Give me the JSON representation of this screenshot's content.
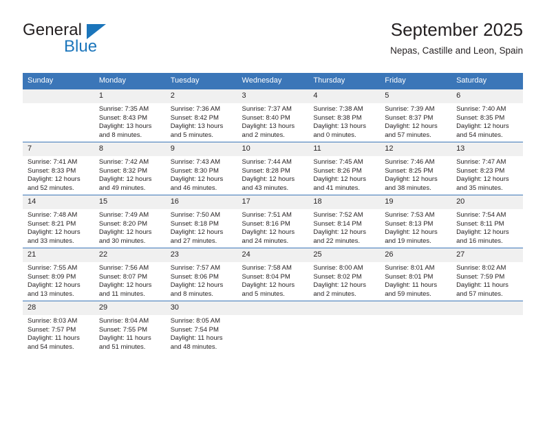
{
  "brand": {
    "name_part1": "General",
    "name_part2": "Blue",
    "triangle_icon": "brand-triangle-icon",
    "accent_color": "#1b75bb"
  },
  "header": {
    "month_title": "September 2025",
    "location": "Nepas, Castille and Leon, Spain"
  },
  "calendar": {
    "header_color": "#3b76b8",
    "daynum_background": "#f0f0f0",
    "weekday_headers": [
      "Sunday",
      "Monday",
      "Tuesday",
      "Wednesday",
      "Thursday",
      "Friday",
      "Saturday"
    ],
    "weeks": [
      [
        {
          "day": "",
          "lines": []
        },
        {
          "day": "1",
          "lines": [
            "Sunrise: 7:35 AM",
            "Sunset: 8:43 PM",
            "Daylight: 13 hours",
            "and 8 minutes."
          ]
        },
        {
          "day": "2",
          "lines": [
            "Sunrise: 7:36 AM",
            "Sunset: 8:42 PM",
            "Daylight: 13 hours",
            "and 5 minutes."
          ]
        },
        {
          "day": "3",
          "lines": [
            "Sunrise: 7:37 AM",
            "Sunset: 8:40 PM",
            "Daylight: 13 hours",
            "and 2 minutes."
          ]
        },
        {
          "day": "4",
          "lines": [
            "Sunrise: 7:38 AM",
            "Sunset: 8:38 PM",
            "Daylight: 13 hours",
            "and 0 minutes."
          ]
        },
        {
          "day": "5",
          "lines": [
            "Sunrise: 7:39 AM",
            "Sunset: 8:37 PM",
            "Daylight: 12 hours",
            "and 57 minutes."
          ]
        },
        {
          "day": "6",
          "lines": [
            "Sunrise: 7:40 AM",
            "Sunset: 8:35 PM",
            "Daylight: 12 hours",
            "and 54 minutes."
          ]
        }
      ],
      [
        {
          "day": "7",
          "lines": [
            "Sunrise: 7:41 AM",
            "Sunset: 8:33 PM",
            "Daylight: 12 hours",
            "and 52 minutes."
          ]
        },
        {
          "day": "8",
          "lines": [
            "Sunrise: 7:42 AM",
            "Sunset: 8:32 PM",
            "Daylight: 12 hours",
            "and 49 minutes."
          ]
        },
        {
          "day": "9",
          "lines": [
            "Sunrise: 7:43 AM",
            "Sunset: 8:30 PM",
            "Daylight: 12 hours",
            "and 46 minutes."
          ]
        },
        {
          "day": "10",
          "lines": [
            "Sunrise: 7:44 AM",
            "Sunset: 8:28 PM",
            "Daylight: 12 hours",
            "and 43 minutes."
          ]
        },
        {
          "day": "11",
          "lines": [
            "Sunrise: 7:45 AM",
            "Sunset: 8:26 PM",
            "Daylight: 12 hours",
            "and 41 minutes."
          ]
        },
        {
          "day": "12",
          "lines": [
            "Sunrise: 7:46 AM",
            "Sunset: 8:25 PM",
            "Daylight: 12 hours",
            "and 38 minutes."
          ]
        },
        {
          "day": "13",
          "lines": [
            "Sunrise: 7:47 AM",
            "Sunset: 8:23 PM",
            "Daylight: 12 hours",
            "and 35 minutes."
          ]
        }
      ],
      [
        {
          "day": "14",
          "lines": [
            "Sunrise: 7:48 AM",
            "Sunset: 8:21 PM",
            "Daylight: 12 hours",
            "and 33 minutes."
          ]
        },
        {
          "day": "15",
          "lines": [
            "Sunrise: 7:49 AM",
            "Sunset: 8:20 PM",
            "Daylight: 12 hours",
            "and 30 minutes."
          ]
        },
        {
          "day": "16",
          "lines": [
            "Sunrise: 7:50 AM",
            "Sunset: 8:18 PM",
            "Daylight: 12 hours",
            "and 27 minutes."
          ]
        },
        {
          "day": "17",
          "lines": [
            "Sunrise: 7:51 AM",
            "Sunset: 8:16 PM",
            "Daylight: 12 hours",
            "and 24 minutes."
          ]
        },
        {
          "day": "18",
          "lines": [
            "Sunrise: 7:52 AM",
            "Sunset: 8:14 PM",
            "Daylight: 12 hours",
            "and 22 minutes."
          ]
        },
        {
          "day": "19",
          "lines": [
            "Sunrise: 7:53 AM",
            "Sunset: 8:13 PM",
            "Daylight: 12 hours",
            "and 19 minutes."
          ]
        },
        {
          "day": "20",
          "lines": [
            "Sunrise: 7:54 AM",
            "Sunset: 8:11 PM",
            "Daylight: 12 hours",
            "and 16 minutes."
          ]
        }
      ],
      [
        {
          "day": "21",
          "lines": [
            "Sunrise: 7:55 AM",
            "Sunset: 8:09 PM",
            "Daylight: 12 hours",
            "and 13 minutes."
          ]
        },
        {
          "day": "22",
          "lines": [
            "Sunrise: 7:56 AM",
            "Sunset: 8:07 PM",
            "Daylight: 12 hours",
            "and 11 minutes."
          ]
        },
        {
          "day": "23",
          "lines": [
            "Sunrise: 7:57 AM",
            "Sunset: 8:06 PM",
            "Daylight: 12 hours",
            "and 8 minutes."
          ]
        },
        {
          "day": "24",
          "lines": [
            "Sunrise: 7:58 AM",
            "Sunset: 8:04 PM",
            "Daylight: 12 hours",
            "and 5 minutes."
          ]
        },
        {
          "day": "25",
          "lines": [
            "Sunrise: 8:00 AM",
            "Sunset: 8:02 PM",
            "Daylight: 12 hours",
            "and 2 minutes."
          ]
        },
        {
          "day": "26",
          "lines": [
            "Sunrise: 8:01 AM",
            "Sunset: 8:01 PM",
            "Daylight: 11 hours",
            "and 59 minutes."
          ]
        },
        {
          "day": "27",
          "lines": [
            "Sunrise: 8:02 AM",
            "Sunset: 7:59 PM",
            "Daylight: 11 hours",
            "and 57 minutes."
          ]
        }
      ],
      [
        {
          "day": "28",
          "lines": [
            "Sunrise: 8:03 AM",
            "Sunset: 7:57 PM",
            "Daylight: 11 hours",
            "and 54 minutes."
          ]
        },
        {
          "day": "29",
          "lines": [
            "Sunrise: 8:04 AM",
            "Sunset: 7:55 PM",
            "Daylight: 11 hours",
            "and 51 minutes."
          ]
        },
        {
          "day": "30",
          "lines": [
            "Sunrise: 8:05 AM",
            "Sunset: 7:54 PM",
            "Daylight: 11 hours",
            "and 48 minutes."
          ]
        },
        {
          "day": "",
          "lines": []
        },
        {
          "day": "",
          "lines": []
        },
        {
          "day": "",
          "lines": []
        },
        {
          "day": "",
          "lines": []
        }
      ]
    ]
  }
}
